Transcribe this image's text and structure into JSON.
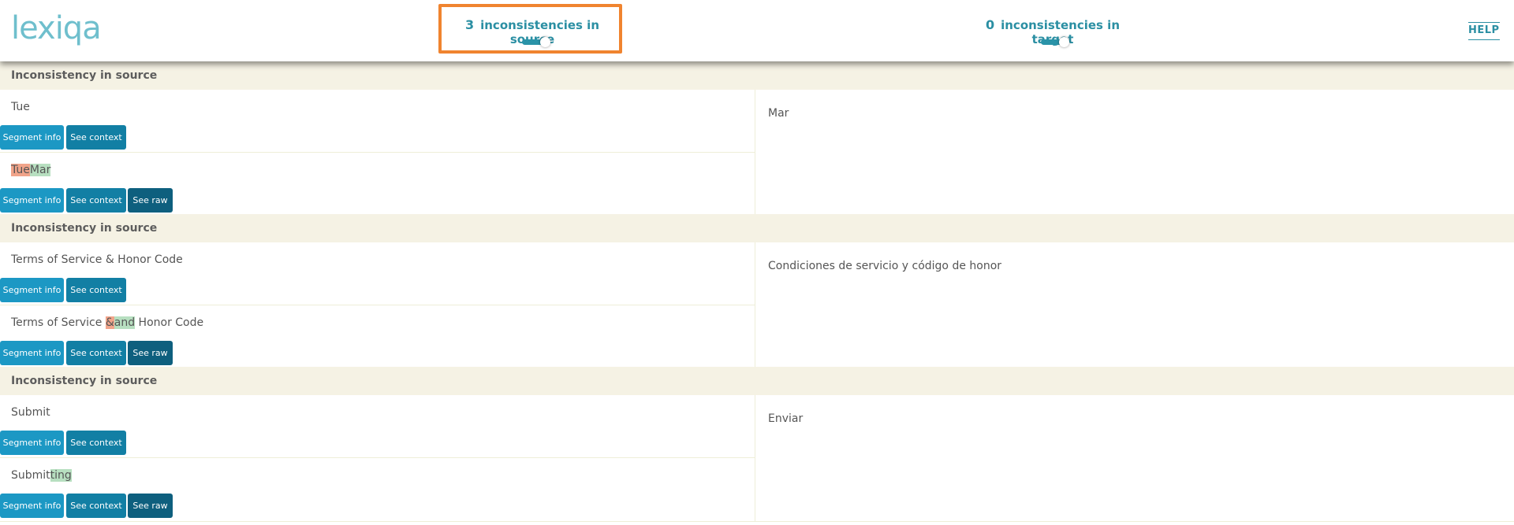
{
  "header": {
    "logo_text": "lexiqa",
    "source_count": "3",
    "source_label": "inconsistencies in source",
    "target_count": "0",
    "target_label": "inconsistencies in target",
    "help_label": "HELP"
  },
  "buttons": {
    "segment_info": "Segment info",
    "see_context": "See context",
    "see_raw": "See raw"
  },
  "groups": [
    {
      "title": "Inconsistency in source",
      "target": "Mar",
      "segments": [
        {
          "text": "Tue"
        },
        {
          "parts": [
            {
              "t": "Tue",
              "kind": "del"
            },
            {
              "t": "Mar",
              "kind": "ins"
            }
          ]
        }
      ]
    },
    {
      "title": "Inconsistency in source",
      "target": "Condiciones de servicio y código de honor",
      "segments": [
        {
          "text": "Terms of Service & Honor Code"
        },
        {
          "parts": [
            {
              "t": "Terms of Service ",
              "kind": ""
            },
            {
              "t": "&",
              "kind": "del"
            },
            {
              "t": "and",
              "kind": "ins"
            },
            {
              "t": " Honor Code",
              "kind": ""
            }
          ]
        }
      ]
    },
    {
      "title": "Inconsistency in source",
      "target": "Enviar",
      "segments": [
        {
          "text": "Submit"
        },
        {
          "parts": [
            {
              "t": "Submit",
              "kind": ""
            },
            {
              "t": "ting",
              "kind": "ins"
            }
          ]
        }
      ]
    }
  ],
  "colors": {
    "accent": "#2b8fa3",
    "focus_border": "#f0842f",
    "group_header_bg": "#f5f2e4",
    "deleted_highlight": "#f1a48a",
    "inserted_highlight": "#b7dfc0"
  }
}
